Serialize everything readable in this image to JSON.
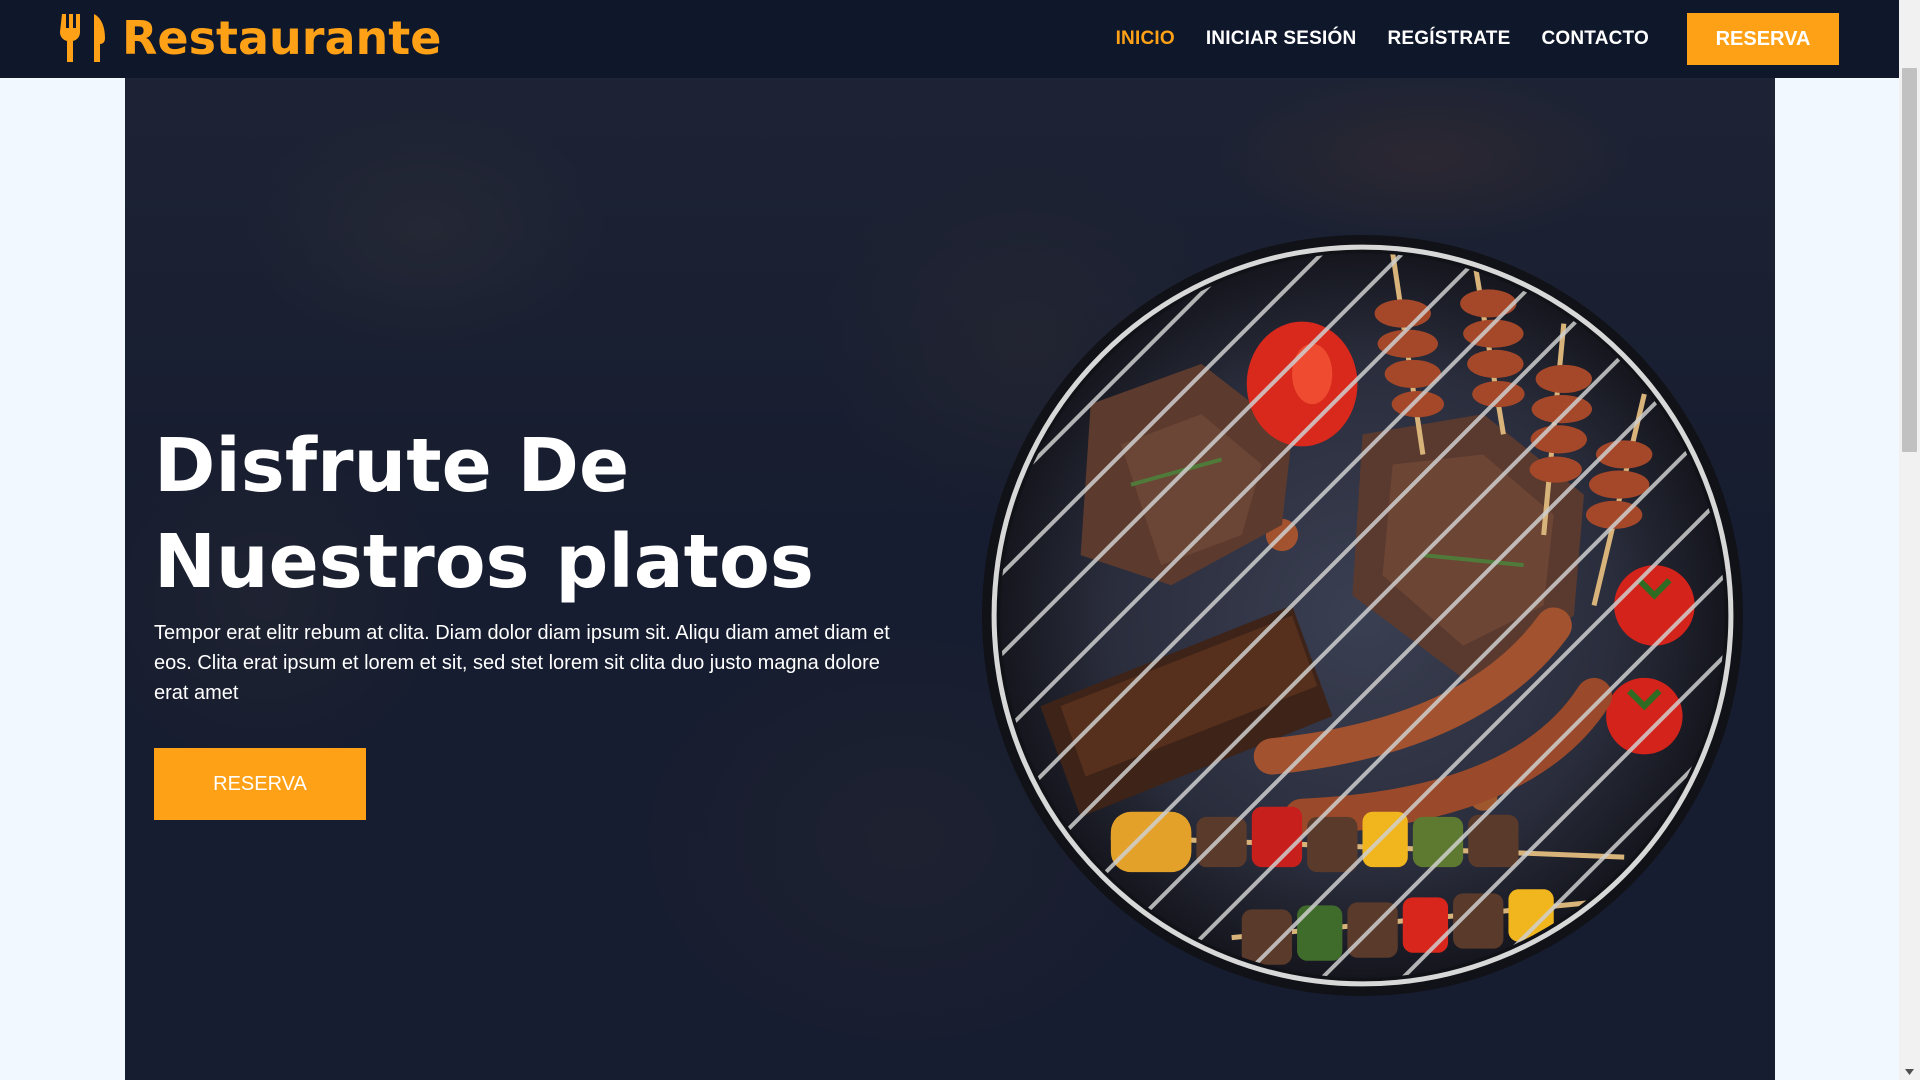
{
  "brand": {
    "name": "Restaurante",
    "icon": "fork-knife-icon",
    "color": "#fea116"
  },
  "nav": {
    "items": [
      {
        "label": "INICIO",
        "active": true
      },
      {
        "label": "INICIAR SESIÓN",
        "active": false
      },
      {
        "label": "REGÍSTRATE",
        "active": false
      },
      {
        "label": "CONTACTO",
        "active": false
      }
    ],
    "reserve_label": "RESERVA"
  },
  "hero": {
    "title_line1": "Disfrute De",
    "title_line2": "Nuestros platos",
    "text": "Tempor erat elitr rebum at clita. Diam dolor diam ipsum sit. Aliqu diam amet diam et eos. Clita erat ipsum et lorem et sit, sed stet lorem sit clita duo justo magna dolore erat amet",
    "button_label": "RESERVA",
    "image": "grill-food-image"
  },
  "colors": {
    "primary": "#fea116",
    "dark": "#0f172b",
    "page_bg": "#f1f8ff"
  }
}
